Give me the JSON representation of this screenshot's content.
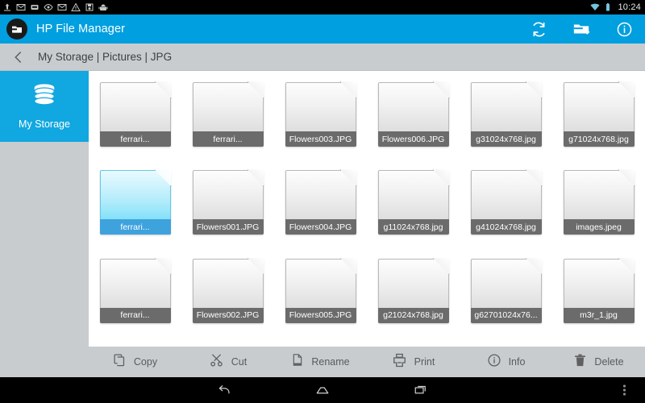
{
  "status_bar": {
    "left_icons": [
      "upload-icon",
      "mail-icon",
      "device-sync-icon",
      "eye-icon",
      "mail-icon",
      "warning-triangle-icon",
      "save-box-icon",
      "android-robot-icon"
    ],
    "right_icons": [
      "wifi-icon",
      "battery-icon"
    ],
    "time": "10:24"
  },
  "app_bar": {
    "title": "HP File Manager",
    "logo_icon": "hp-folder-logo-icon",
    "background_color": "#009fdf",
    "actions": [
      {
        "name": "refresh-button",
        "icon": "refresh-icon"
      },
      {
        "name": "new-folder-button",
        "icon": "new-folder-icon"
      },
      {
        "name": "info-button",
        "icon": "info-circle-icon"
      }
    ]
  },
  "breadcrumb": {
    "back_icon": "chevron-left-icon",
    "path": "My Storage | Pictures | JPG"
  },
  "sidebar": {
    "items": [
      {
        "label": "My Storage",
        "icon": "database-stack-icon",
        "selected": true,
        "color": "#11a7e0"
      }
    ]
  },
  "files": {
    "rows": [
      [
        {
          "name": "ferrari...",
          "selected": false
        },
        {
          "name": "ferrari...",
          "selected": false
        },
        {
          "name": "Flowers003.JPG",
          "selected": false
        },
        {
          "name": "Flowers006.JPG",
          "selected": false
        },
        {
          "name": "g31024x768.jpg",
          "selected": false
        },
        {
          "name": "g71024x768.jpg",
          "selected": false
        }
      ],
      [
        {
          "name": "ferrari...",
          "selected": true
        },
        {
          "name": "Flowers001.JPG",
          "selected": false
        },
        {
          "name": "Flowers004.JPG",
          "selected": false
        },
        {
          "name": "g11024x768.jpg",
          "selected": false
        },
        {
          "name": "g41024x768.jpg",
          "selected": false
        },
        {
          "name": "images.jpeg",
          "selected": false
        }
      ],
      [
        {
          "name": "ferrari...",
          "selected": false
        },
        {
          "name": "Flowers002.JPG",
          "selected": false
        },
        {
          "name": "Flowers005.JPG",
          "selected": false
        },
        {
          "name": "g21024x768.jpg",
          "selected": false
        },
        {
          "name": "g62701024x76...",
          "selected": false
        },
        {
          "name": "m3r_1.jpg",
          "selected": false
        }
      ]
    ]
  },
  "toolbar": {
    "items": [
      {
        "label": "Copy",
        "icon": "copy-icon"
      },
      {
        "label": "Cut",
        "icon": "scissors-icon"
      },
      {
        "label": "Rename",
        "icon": "document-icon"
      },
      {
        "label": "Print",
        "icon": "printer-icon"
      },
      {
        "label": "Info",
        "icon": "info-circle-icon"
      },
      {
        "label": "Delete",
        "icon": "trash-icon"
      }
    ]
  },
  "nav_bar": {
    "buttons": [
      {
        "name": "nav-back-button",
        "icon": "back-arrow-icon"
      },
      {
        "name": "nav-home-button",
        "icon": "home-icon"
      },
      {
        "name": "nav-recents-button",
        "icon": "recents-icon"
      }
    ],
    "menu_icon": "overflow-menu-icon"
  }
}
